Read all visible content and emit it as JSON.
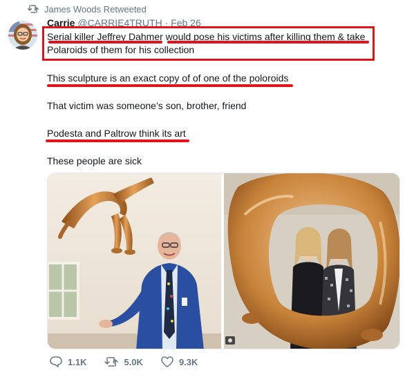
{
  "retweet_bar": {
    "label": "James Woods Retweeted",
    "icon": "retweet-icon"
  },
  "tweet": {
    "author_name": "Carrie",
    "author_handle": "@CARRIE4TRUTH",
    "separator": "·",
    "date": "Feb 26",
    "paragraphs": [
      "Serial killer Jeffrey Dahmer would pose his victims after killing them & take",
      "Polaroids of them for his collection",
      "This sculpture is an exact copy of of one of the poloroids",
      "That victim was someone’s son, brother, friend",
      "Podesta and Paltrow think its art",
      "These people are sick"
    ]
  },
  "actions": {
    "replies": "1.1K",
    "retweets": "5.0K",
    "likes": "9.3K"
  },
  "colors": {
    "annotation_red": "#e3121b",
    "muted_text": "#657786",
    "sculpture_gold": "#c8833a"
  }
}
